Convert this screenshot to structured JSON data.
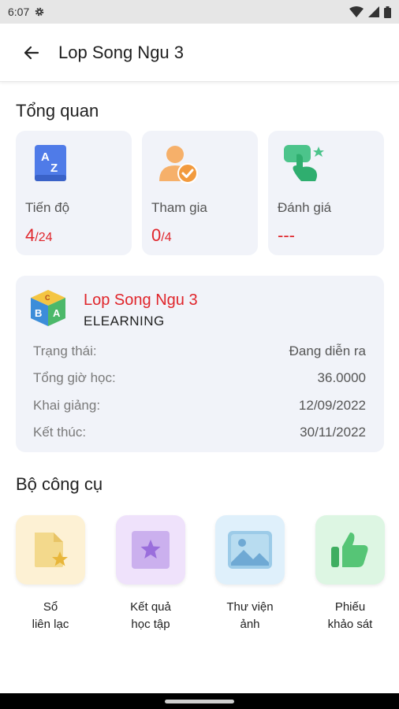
{
  "status": {
    "time": "6:07"
  },
  "header": {
    "title": "Lop Song Ngu 3"
  },
  "overview": {
    "title": "Tổng quan",
    "cards": [
      {
        "label": "Tiến độ",
        "value": "4",
        "total": "/24",
        "icon": "az-book-icon"
      },
      {
        "label": "Tham gia",
        "value": "0",
        "total": "/4",
        "icon": "user-check-icon"
      },
      {
        "label": "Đánh giá",
        "value": "---",
        "total": "",
        "icon": "tap-star-icon"
      }
    ]
  },
  "course": {
    "name": "Lop Song Ngu 3",
    "type": "ELEARNING",
    "rows": [
      {
        "label": "Trạng thái:",
        "value": "Đang diễn ra"
      },
      {
        "label": "Tổng giờ học:",
        "value": "36.0000"
      },
      {
        "label": "Khai giảng:",
        "value": "12/09/2022"
      },
      {
        "label": "Kết thúc:",
        "value": "30/11/2022"
      }
    ]
  },
  "tools": {
    "title": "Bộ công cụ",
    "items": [
      {
        "line1": "Sổ",
        "line2": "liên lạc",
        "icon": "document-star-icon",
        "color": "#fdf1d4"
      },
      {
        "line1": "Kết quả",
        "line2": "học tập",
        "icon": "star-square-icon",
        "color": "#efe2fb"
      },
      {
        "line1": "Thư viện",
        "line2": "ảnh",
        "icon": "image-icon",
        "color": "#dff0fb"
      },
      {
        "line1": "Phiếu",
        "line2": "khảo sát",
        "icon": "thumbs-up-icon",
        "color": "#ddf6e3"
      }
    ]
  },
  "colors": {
    "accent_red": "#e0252b",
    "card_bg": "#f1f3f9"
  }
}
